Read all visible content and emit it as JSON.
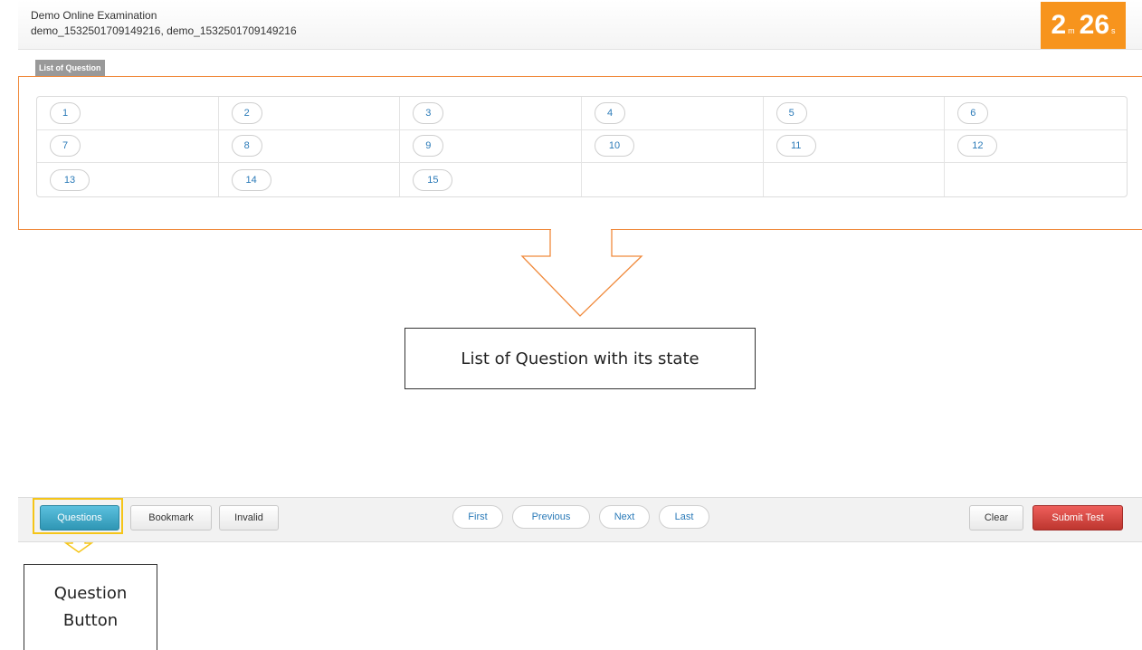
{
  "header": {
    "exam_title": "Demo Online Examination",
    "exam_user": "demo_1532501709149216, demo_1532501709149216",
    "timer": {
      "minutes": "2",
      "minutes_unit": "m",
      "seconds": "26",
      "seconds_unit": "s"
    }
  },
  "question_list": {
    "tab_label": "List of Question",
    "questions": [
      "1",
      "2",
      "3",
      "4",
      "5",
      "6",
      "7",
      "8",
      "9",
      "10",
      "11",
      "12",
      "13",
      "14",
      "15"
    ]
  },
  "callouts": {
    "list_annotation": "List of Question with its state",
    "button_annotation_line1": "Question",
    "button_annotation_line2": "Button"
  },
  "toolbar": {
    "questions_label": "Questions",
    "bookmark_label": "Bookmark",
    "invalid_label": "Invalid",
    "first_label": "First",
    "previous_label": "Previous",
    "next_label": "Next",
    "last_label": "Last",
    "clear_label": "Clear",
    "submit_label": "Submit Test"
  },
  "colors": {
    "timer_bg": "#f7941d",
    "annotation_orange": "#f08a3c",
    "highlight_yellow": "#f5c518",
    "primary_button": "#2f96b4",
    "danger_button": "#bd362f"
  }
}
